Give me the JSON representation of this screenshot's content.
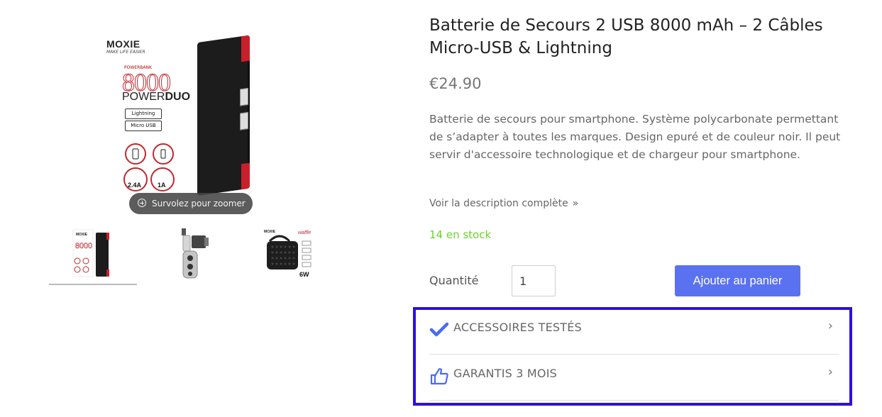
{
  "gallery": {
    "zoom_hint": "Survolez pour zoomer",
    "package": {
      "brand": "MOXIE",
      "tagline": "MAKE LIFE EASIER",
      "powerbank": "POWERBANK",
      "capacity": "8000",
      "name_light": "POWER",
      "name_bold": "DUO",
      "cable_1": "Lightning",
      "cable_2": "Micro USB",
      "port_1": "2.4A",
      "port_2": "1A"
    },
    "thumbnails": [
      {
        "alt": "Batterie de secours Moxie 8000 Power Duo",
        "active": true
      },
      {
        "alt": "Objectif téléphoto pour smartphone",
        "active": false
      },
      {
        "alt": "Enceinte waffle 6W",
        "active": false,
        "badge": "6W",
        "brand": "waffle"
      }
    ]
  },
  "product": {
    "title": "Batterie de Secours 2 USB 8000 mAh – 2 Câbles Micro-USB & Lightning",
    "price": "€24.90",
    "description": "Batterie de secours pour smartphone. Système polycarbonate permettant de s’adapter à toutes les marques. Design epuré et de couleur noir. Il peut servir d'accessoire technologique et de chargeur pour smartphone.",
    "full_description_link": "Voir la description complète",
    "stock": "14 en stock",
    "quantity_label": "Quantité",
    "quantity_value": "1",
    "add_to_cart": "Ajouter au panier"
  },
  "features": [
    {
      "label": "ACCESSOIRES TESTÉS",
      "icon": "checkmark-icon"
    },
    {
      "label": "GARANTIS 3 MOIS",
      "icon": "thumbs-up-icon"
    }
  ],
  "colors": {
    "accent_button": "#5a72ef",
    "stock_green": "#6bd12e",
    "highlight_border": "#2d0fe0",
    "icon_blue": "#4a6cf0"
  }
}
